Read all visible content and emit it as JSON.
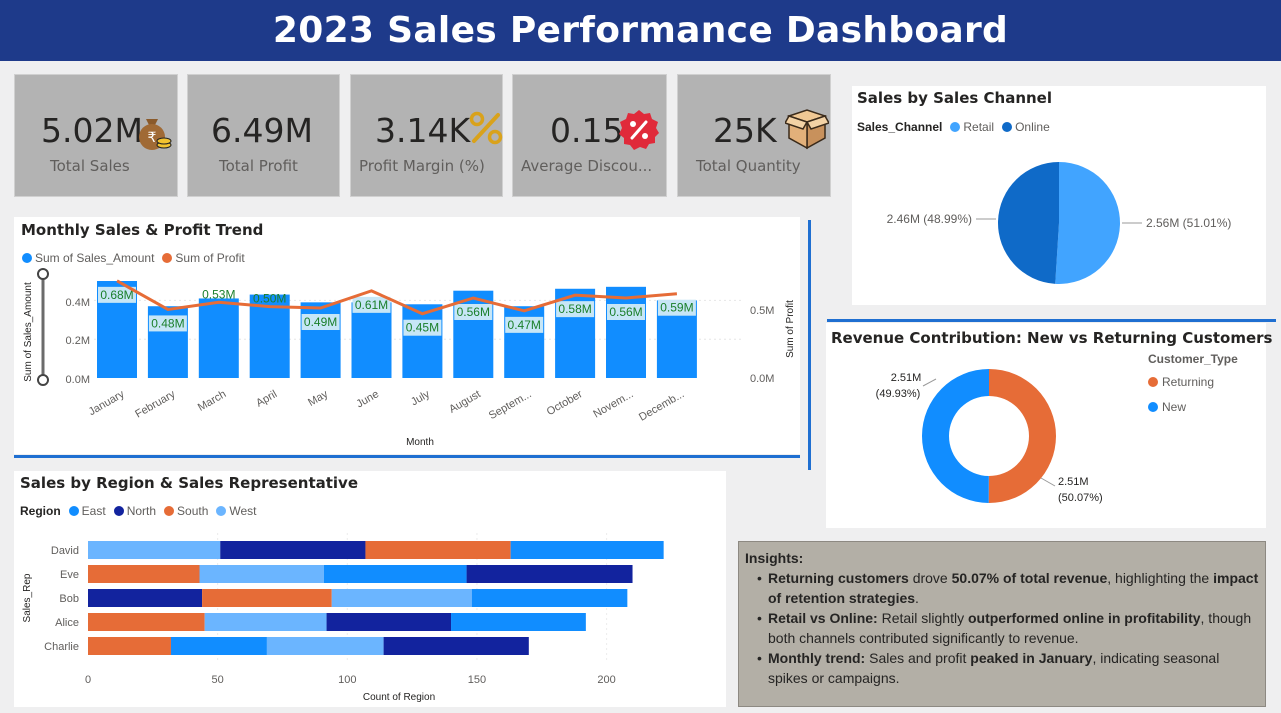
{
  "header": {
    "title": "2023 Sales Performance Dashboard"
  },
  "kpis": [
    {
      "value": "5.02M",
      "label": "Total Sales",
      "icon": "money-bag-icon"
    },
    {
      "value": "6.49M",
      "label": "Total Profit",
      "icon": ""
    },
    {
      "value": "3.14K",
      "label": "Profit Margin (%)",
      "icon": "percent-icon"
    },
    {
      "value": "0.15",
      "label": "Average Discou...",
      "icon": "discount-badge-icon"
    },
    {
      "value": "25K",
      "label": "Total Quantity",
      "icon": "box-icon"
    }
  ],
  "colors": {
    "header": "#1e3a8a",
    "east": "#118dff",
    "north": "#12239e",
    "south": "#e66c37",
    "west": "#6bb5ff",
    "retail": "#41a4ff",
    "online": "#0f6ac8",
    "profit_line": "#e66c37",
    "sales_bar": "#118dff"
  },
  "monthly": {
    "title": "Monthly Sales & Profit Trend",
    "legend": [
      "Sum of Sales_Amount",
      "Sum of Profit"
    ],
    "ylabel_left": "Sum of Sales_Amount",
    "ylabel_right": "Sum of Profit",
    "xlabel": "Month",
    "left_ticks": [
      "0.4M",
      "0.2M",
      "0.0M"
    ],
    "right_ticks": [
      "0.5M",
      "0.0M"
    ]
  },
  "channel": {
    "title": "Sales by Sales Channel",
    "legend_title": "Sales_Channel",
    "legend": [
      "Retail",
      "Online"
    ],
    "labels": [
      "2.56M (51.01%)",
      "2.46M (48.99%)"
    ]
  },
  "customers": {
    "title": "Revenue Contribution: New vs Returning Customers",
    "legend_title": "Customer_Type",
    "legend": [
      "Returning",
      "New"
    ],
    "label_new_1": "2.51M",
    "label_new_2": "(49.93%)",
    "label_ret_1": "2.51M",
    "label_ret_2": "(50.07%)"
  },
  "region": {
    "title": "Sales by Region & Sales Representative",
    "legend_title": "Region",
    "legend": [
      "East",
      "North",
      "South",
      "West"
    ],
    "ylabel": "Sales_Rep",
    "xlabel": "Count of Region",
    "xticks": [
      "0",
      "50",
      "100",
      "150",
      "200"
    ]
  },
  "insights": {
    "title": "Insights:",
    "b1_strong1": "Returning customers",
    "b1_t1": " drove ",
    "b1_strong2": "50.07% of total revenue",
    "b1_t2": ", highlighting the ",
    "b1_strong3": "impact of retention strategies",
    "b1_t3": ".",
    "b2_strong1": "Retail vs Online:",
    "b2_t1": " Retail slightly ",
    "b2_strong2": "outperformed online in profitability",
    "b2_t2": ", though both channels contributed significantly to revenue.",
    "b3_strong1": "Monthly trend:",
    "b3_t1": " Sales and profit ",
    "b3_strong2": "peaked in January",
    "b3_t2": ", indicating seasonal spikes or campaigns."
  },
  "chart_data": [
    {
      "type": "bar+line",
      "title": "Monthly Sales & Profit Trend",
      "xlabel": "Month",
      "categories": [
        "January",
        "February",
        "March",
        "April",
        "May",
        "June",
        "July",
        "August",
        "Septem...",
        "October",
        "Novem...",
        "Decemb..."
      ],
      "series": [
        {
          "name": "Sum of Sales_Amount",
          "axis": "left",
          "values": [
            0.5,
            0.37,
            0.41,
            0.43,
            0.39,
            0.39,
            0.38,
            0.45,
            0.37,
            0.46,
            0.47,
            0.4
          ]
        },
        {
          "name": "Sum of Profit",
          "axis": "right",
          "values": [
            0.68,
            0.48,
            0.53,
            0.5,
            0.49,
            0.61,
            0.45,
            0.56,
            0.47,
            0.58,
            0.56,
            0.59
          ]
        }
      ],
      "data_labels": [
        "0.68M",
        "0.48M",
        "0.53M",
        "0.50M",
        "0.49M",
        "0.61M",
        "0.45M",
        "0.56M",
        "0.47M",
        "0.58M",
        "0.56M",
        "0.59M"
      ],
      "ylim_left": [
        0,
        0.5
      ],
      "ylim_right": [
        0,
        0.7
      ]
    },
    {
      "type": "pie",
      "title": "Sales by Sales Channel",
      "categories": [
        "Retail",
        "Online"
      ],
      "values": [
        2.56,
        2.46
      ],
      "percent": [
        51.01,
        48.99
      ]
    },
    {
      "type": "donut",
      "title": "Revenue Contribution: New vs Returning Customers",
      "categories": [
        "Returning",
        "New"
      ],
      "values": [
        2.51,
        2.51
      ],
      "percent": [
        50.07,
        49.93
      ]
    },
    {
      "type": "stacked-bar-horizontal",
      "title": "Sales by Region & Sales Representative",
      "xlabel": "Count of Region",
      "ylabel": "Sales_Rep",
      "xlim": [
        0,
        220
      ],
      "rows": [
        {
          "rep": "David",
          "segments": [
            [
              "West",
              51
            ],
            [
              "North",
              56
            ],
            [
              "South",
              56
            ],
            [
              "East",
              59
            ]
          ]
        },
        {
          "rep": "Eve",
          "segments": [
            [
              "South",
              43
            ],
            [
              "West",
              48
            ],
            [
              "East",
              55
            ],
            [
              "North",
              64
            ]
          ]
        },
        {
          "rep": "Bob",
          "segments": [
            [
              "North",
              44
            ],
            [
              "South",
              50
            ],
            [
              "West",
              54
            ],
            [
              "East",
              60
            ]
          ]
        },
        {
          "rep": "Alice",
          "segments": [
            [
              "South",
              45
            ],
            [
              "West",
              47
            ],
            [
              "North",
              48
            ],
            [
              "East",
              52
            ]
          ]
        },
        {
          "rep": "Charlie",
          "segments": [
            [
              "South",
              32
            ],
            [
              "East",
              37
            ],
            [
              "West",
              45
            ],
            [
              "North",
              56
            ]
          ]
        }
      ]
    }
  ]
}
